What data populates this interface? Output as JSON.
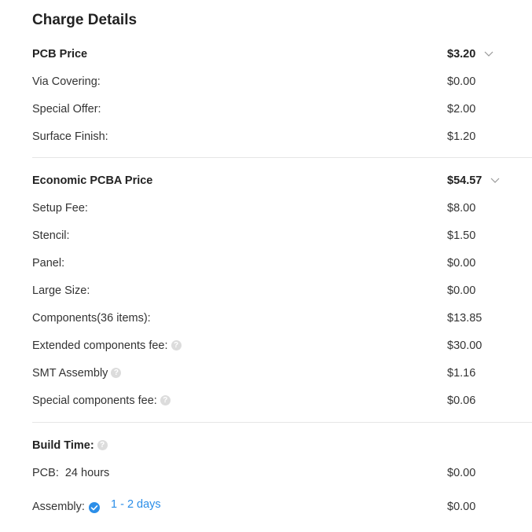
{
  "title": "Charge Details",
  "pcb_section": {
    "label": "PCB Price",
    "total": "$3.20",
    "rows": [
      {
        "label": "Via Covering:",
        "value": "$0.00"
      },
      {
        "label": "Special Offer:",
        "value": "$2.00"
      },
      {
        "label": "Surface Finish:",
        "value": "$1.20"
      }
    ]
  },
  "pcba_section": {
    "label": "Economic PCBA Price",
    "total": "$54.57",
    "rows": [
      {
        "label": "Setup Fee:",
        "value": "$8.00"
      },
      {
        "label": "Stencil:",
        "value": "$1.50"
      },
      {
        "label": "Panel:",
        "value": "$0.00"
      },
      {
        "label": "Large Size:",
        "value": "$0.00"
      },
      {
        "label": "Components(36 items):",
        "value": "$13.85"
      },
      {
        "label": "Extended components fee:",
        "value": "$30.00"
      },
      {
        "label": "SMT Assembly",
        "value": "$1.16"
      },
      {
        "label": "Special components fee:",
        "value": "$0.06"
      }
    ]
  },
  "build_time": {
    "label": "Build Time:",
    "pcb_label": "PCB:",
    "pcb_time": "24 hours",
    "pcb_value": "$0.00",
    "assembly_label": "Assembly:",
    "assembly_time": "1 - 2 days",
    "assembly_value": "$0.00"
  },
  "icons": {
    "help": "?",
    "chevron": "chevron-down-icon",
    "check": "check-circle-icon"
  },
  "colors": {
    "accent": "#2b8ee8",
    "help_icon": "#dcdcdc",
    "divider": "#e6e6e6"
  }
}
